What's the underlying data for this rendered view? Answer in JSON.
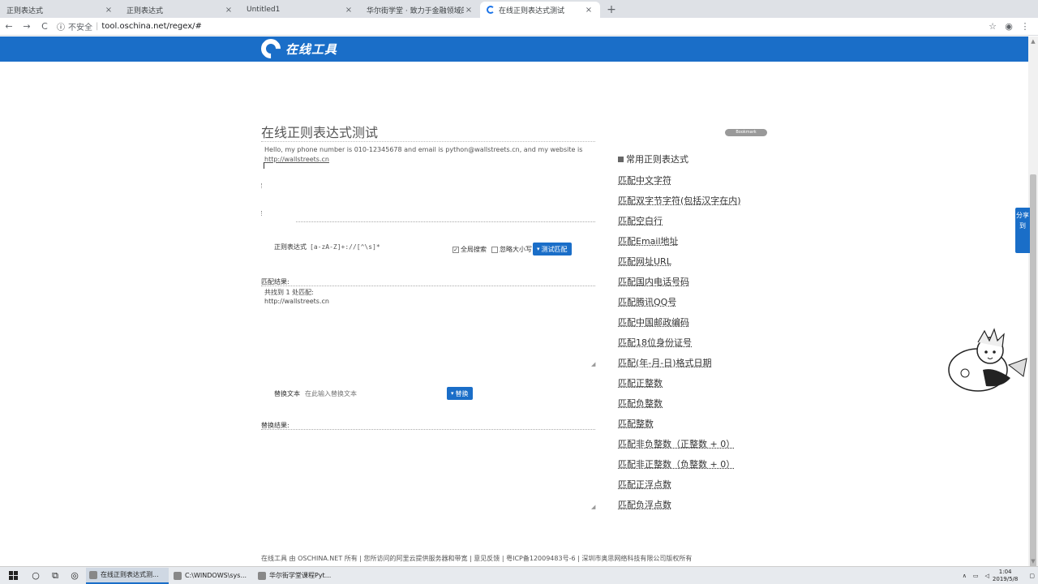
{
  "browser": {
    "tabs": [
      {
        "label": "正则表达式",
        "active": false
      },
      {
        "label": "正则表达式",
        "active": false
      },
      {
        "label": "Untitled1",
        "active": false
      },
      {
        "label": "华尔街学堂 · 致力于金融领域的",
        "active": false
      },
      {
        "label": "在线正则表达式测试",
        "active": true
      }
    ],
    "new_tab": "+",
    "nav": {
      "back": "←",
      "forward": "→",
      "reload": "C"
    },
    "security_label": "不安全",
    "url": "tool.oschina.net/regex/#"
  },
  "site": {
    "logo_text": "在线工具",
    "page_title": "在线正则表达式测试",
    "source_text_line1": "Hello, my phone number is 010-12345678 and email is python@wallstreets.cn, and my website is",
    "source_text_line2": "http://wallstreets.cn",
    "regex_label": "正则表达式",
    "regex_value": "[a-zA-Z]+://[^\\s]*",
    "global_search_label": "全局搜索",
    "ignore_case_label": "忽略大小写",
    "test_button": "测试匹配",
    "match_result_label": "匹配结果:",
    "match_summary": "共找到 1 处匹配:",
    "match_value": "http://wallstreets.cn",
    "replace_label": "替换文本",
    "replace_placeholder": "在此输入替换文本",
    "replace_button": "替换",
    "replace_result_label": "替换结果:"
  },
  "sidebar": {
    "badge": "Bookmark",
    "title": "常用正则表达式",
    "items": [
      "匹配中文字符",
      "匹配双字节字符(包括汉字在内)",
      "匹配空白行",
      "匹配Email地址",
      "匹配网址URL",
      "匹配国内电话号码",
      "匹配腾讯QQ号",
      "匹配中国邮政编码",
      "匹配18位身份证号",
      "匹配(年-月-日)格式日期",
      "匹配正整数",
      "匹配负整数",
      "匹配整数",
      "匹配非负整数（正整数 + 0）",
      "匹配非正整数（负整数 + 0）",
      "匹配正浮点数",
      "匹配负浮点数"
    ]
  },
  "share": {
    "label": "分享到"
  },
  "footer": "在线工具 由 OSCHINA.NET 所有 | 您所访问的阿里云提供服务器和带宽 | 意见反馈 | 粤ICP备12009483号-6 | 深圳市奥思网络科技有限公司版权所有",
  "taskbar": {
    "items": [
      {
        "label": "在线正则表达式测...",
        "active": true
      },
      {
        "label": "C:\\WINDOWS\\sys...",
        "active": false
      },
      {
        "label": "华尔街学堂课程Pyt...",
        "active": false
      }
    ],
    "time": "1:04",
    "date": "2019/5/8"
  },
  "colors": {
    "brand": "#1a6ec8"
  }
}
